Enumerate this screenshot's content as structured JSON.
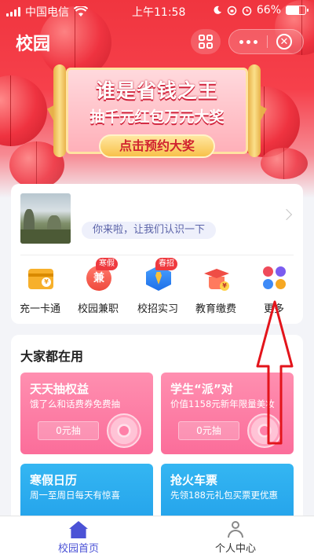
{
  "status_bar": {
    "carrier": "中国电信",
    "time": "上午11:58",
    "battery": "66%",
    "battery_level": 0.66
  },
  "header": {
    "title": "校园"
  },
  "banner": {
    "title": "谁是省钱之王",
    "subtitle": "抽千元红包万元大奖",
    "cta": "点击预约大奖"
  },
  "profile": {
    "greeting": "你来啦，让我们认识一下"
  },
  "quick_menu": [
    {
      "label": "充一卡通",
      "icon": "campus-card-icon",
      "badge": ""
    },
    {
      "label": "校园兼职",
      "icon": "part-time-icon",
      "badge": "寒假"
    },
    {
      "label": "校招实习",
      "icon": "internship-icon",
      "badge": "春招"
    },
    {
      "label": "教育缴费",
      "icon": "education-fee-icon",
      "badge": ""
    },
    {
      "label": "更多",
      "icon": "more-grid-icon",
      "badge": ""
    }
  ],
  "section": {
    "title": "大家都在用",
    "cards": [
      {
        "title": "天天抽权益",
        "subtitle": "饿了么和话费券免费抽",
        "button": "0元抽"
      },
      {
        "title": "学生“派”对",
        "subtitle": "价值1158元新年限量美妆",
        "button": "0元抽"
      },
      {
        "title": "寒假日历",
        "subtitle": "周一至周日每天有惊喜",
        "button": ""
      },
      {
        "title": "抢火车票",
        "subtitle": "先领188元礼包买票更优惠",
        "button": ""
      }
    ]
  },
  "tabbar": {
    "home": "校园首页",
    "me": "个人中心"
  },
  "colors": {
    "hero_red": "#f0353f",
    "accent_blue": "#4b52d6",
    "promo_pink": "#fb6d9a",
    "promo_blue": "#1e9be8",
    "annotation_red": "#e3141b"
  }
}
